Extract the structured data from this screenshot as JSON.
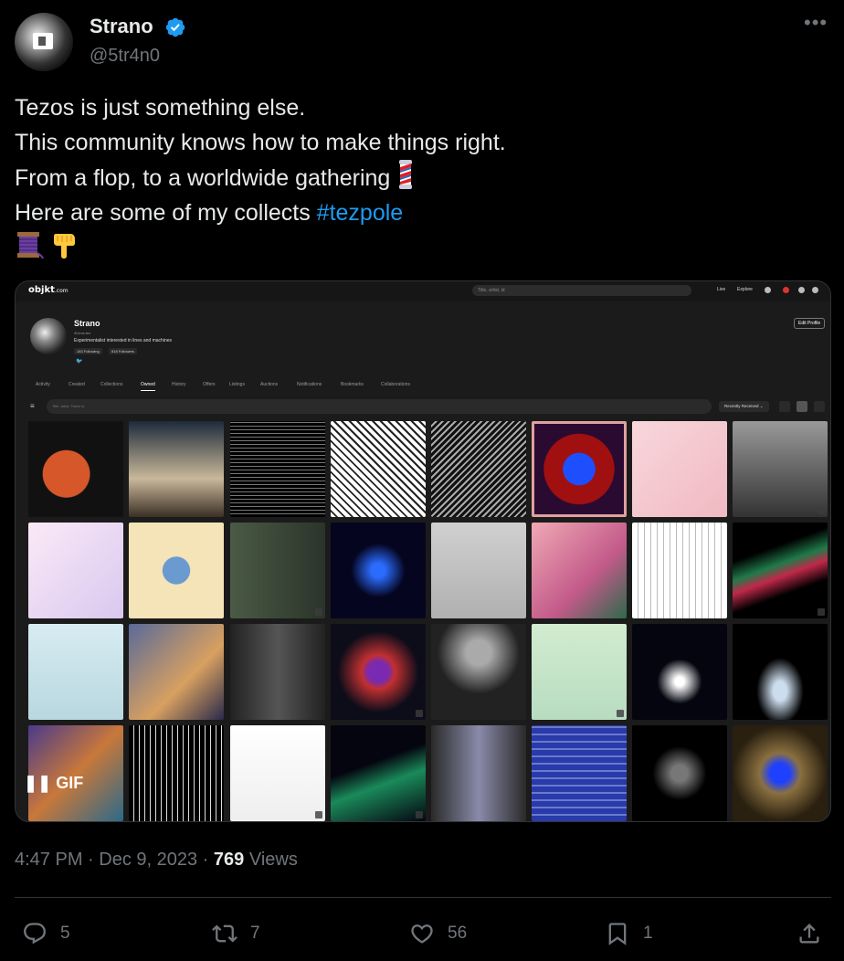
{
  "author": {
    "name": "Strano",
    "handle": "@5tr4n0",
    "verified": true
  },
  "tweet": {
    "lines": [
      "Tezos is just something else.",
      "This community knows how to make things right.",
      "From a flop, to a worldwide gathering",
      "Here are some of my collects "
    ],
    "hashtag": "#tezpole",
    "emojis": [
      "barber-pole",
      "thread-spool",
      "pointing-down"
    ]
  },
  "media": {
    "type": "GIF",
    "gif_label": "GIF",
    "screenshot": {
      "site_logo": "objkt",
      "site_logo_suffix": ".com",
      "search_placeholder": "Title, artist, id",
      "nav": [
        "Live",
        "Explore"
      ],
      "profile_name": "Strano",
      "profile_sub": "4l1ens.tez",
      "bio": "Experimentalist interested in lines and machines",
      "following": "183 Following",
      "followers": "818 Followers",
      "edit_profile": "Edit Profile",
      "tabs": [
        "Activity",
        "Created",
        "Collections",
        "Owned",
        "History",
        "Offers",
        "Listings",
        "Auctions",
        "Notifications",
        "Bookmarks",
        "Collaborations"
      ],
      "active_tab": "Owned",
      "filter_placeholder": "Title, artist, Token id",
      "sort": "Recently Received"
    }
  },
  "meta": {
    "time": "4:47 PM",
    "date": "Dec 9, 2023",
    "views_count": "769",
    "views_label": "Views"
  },
  "actions": {
    "replies": "5",
    "reposts": "7",
    "likes": "56",
    "bookmarks": "1"
  },
  "colors": {
    "background": "#000000",
    "text": "#e7e9ea",
    "muted": "#71767b",
    "accent": "#1d9bf0",
    "verified": "#1d9bf0"
  }
}
